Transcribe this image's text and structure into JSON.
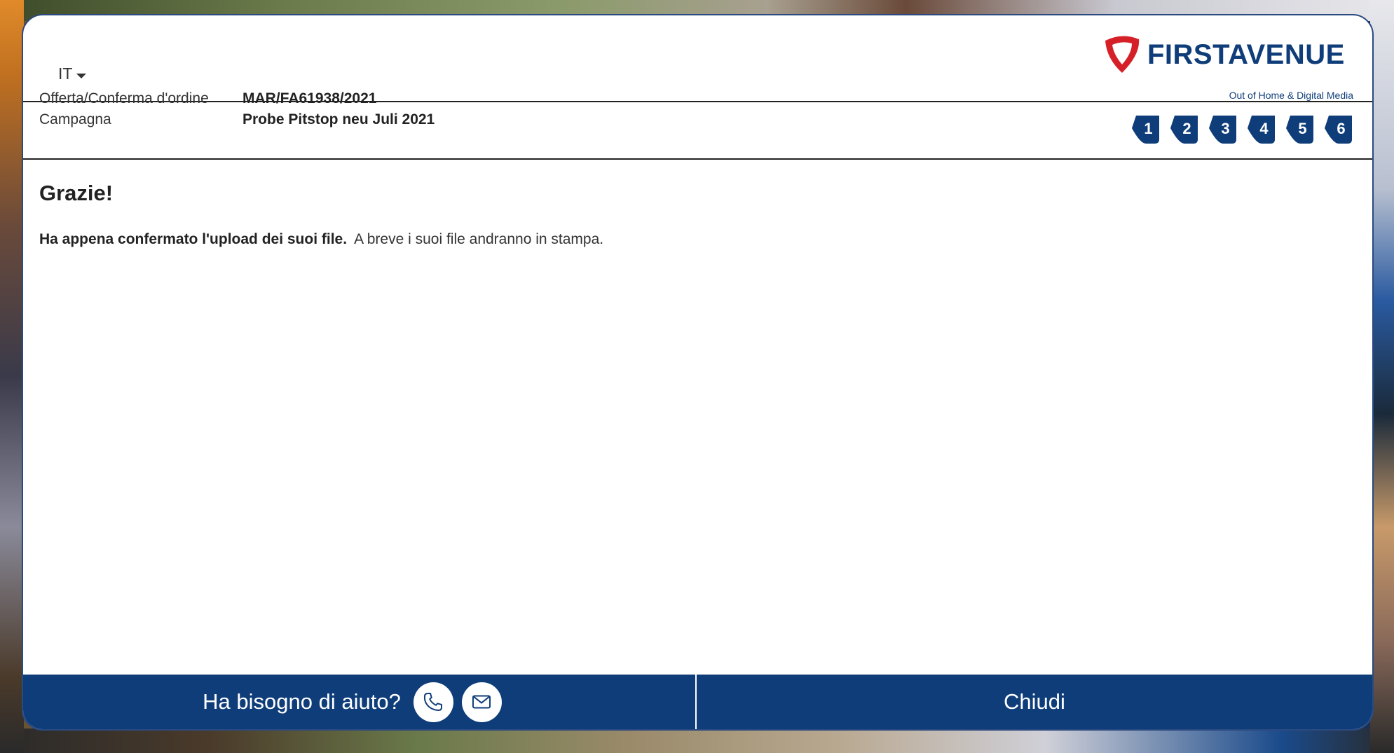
{
  "header": {
    "language": "IT",
    "logo": {
      "name": "FIRSTAVENUE",
      "tagline": "Out of Home & Digital Media",
      "brand_color": "#0f3d7a",
      "accent_color": "#d62027"
    }
  },
  "info": {
    "order_label": "Offerta/Conferma d'ordine",
    "order_value": "MAR/FA61938/2021",
    "campaign_label": "Campagna",
    "campaign_value": "Probe Pitstop neu Juli 2021"
  },
  "steps": [
    "1",
    "2",
    "3",
    "4",
    "5",
    "6"
  ],
  "content": {
    "title": "Grazie!",
    "message_bold": "Ha appena confermato l'upload dei suoi file.",
    "message_rest": "A breve i suoi file andranno in stampa."
  },
  "footer": {
    "help_label": "Ha bisogno di aiuto?",
    "phone_icon": "phone-icon",
    "mail_icon": "mail-icon",
    "close_label": "Chiudi"
  }
}
